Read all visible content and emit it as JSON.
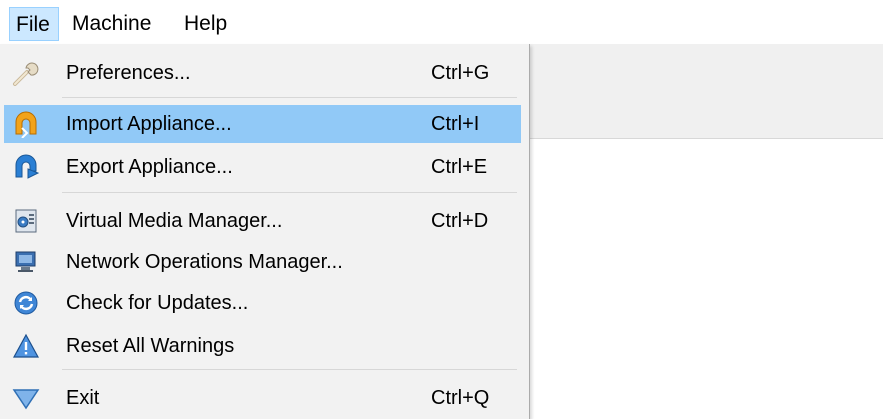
{
  "menubar": {
    "items": [
      {
        "label": "File"
      },
      {
        "label": "Machine"
      },
      {
        "label": "Help"
      }
    ]
  },
  "file_menu": {
    "items": [
      {
        "label": "Preferences...",
        "shortcut": "Ctrl+G",
        "icon": "wrench-icon"
      },
      {
        "label": "Import Appliance...",
        "shortcut": "Ctrl+I",
        "icon": "import-appliance-icon",
        "highlighted": true
      },
      {
        "label": "Export Appliance...",
        "shortcut": "Ctrl+E",
        "icon": "export-appliance-icon"
      },
      {
        "label": "Virtual Media Manager...",
        "shortcut": "Ctrl+D",
        "icon": "media-manager-icon"
      },
      {
        "label": "Network Operations Manager...",
        "shortcut": "",
        "icon": "network-monitor-icon"
      },
      {
        "label": "Check for Updates...",
        "shortcut": "",
        "icon": "refresh-icon"
      },
      {
        "label": "Reset All Warnings",
        "shortcut": "",
        "icon": "warning-icon"
      },
      {
        "label": "Exit",
        "shortcut": "Ctrl+Q",
        "icon": "exit-triangle-icon"
      }
    ]
  },
  "colors": {
    "menubar_active_bg": "#cce8ff",
    "menu_bg": "#f2f2f2",
    "menu_highlight": "#91c9f7",
    "icon_orange": "#f2a31b",
    "icon_blue": "#2a7fd4"
  }
}
